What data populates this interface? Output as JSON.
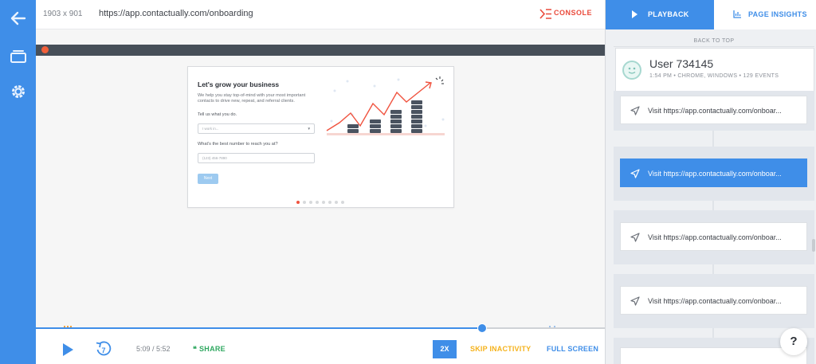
{
  "rail": {
    "back_icon": "arrow-left-icon",
    "sessions_icon": "stack-icon",
    "settings_icon": "gear-icon"
  },
  "topbar": {
    "dimensions": "1903 x 901",
    "url": "https://app.contactually.com/onboarding",
    "console_label": "CONSOLE"
  },
  "card": {
    "title": "Let's grow your business",
    "description": "We help you stay top-of-mind with your most important contacts to drive new, repeat, and referral clients.",
    "label_1": "Tell us what you do.",
    "select_placeholder": "I work in...",
    "label_2": "What's the best number to reach you at?",
    "phone_placeholder": "(123) 456-7890",
    "next_label": "Next",
    "progress_step": 1,
    "progress_total": 8
  },
  "controls": {
    "time": "5:09 / 5:52",
    "rewind_seconds": "7",
    "share_label": "SHARE",
    "speed_label": "2X",
    "skip_label": "SKIP INACTIVITY",
    "fullscreen_label": "FULL SCREEN",
    "progress_fraction": 0.88
  },
  "panel": {
    "tab_playback": "PLAYBACK",
    "tab_insights": "PAGE INSIGHTS",
    "back_to_top": "BACK TO TOP",
    "user_name": "User 734145",
    "user_meta": "1:54 PM • CHROME, WINDOWS • 129 EVENTS",
    "events": [
      {
        "text": "Visit https://app.contactually.com/onboar..."
      },
      {
        "text": "Visit https://app.contactually.com/onboar..."
      },
      {
        "text": "Visit https://app.contactually.com/onboar..."
      },
      {
        "text": "Visit https://app.contactually.com/onboar..."
      }
    ],
    "help_label": "?"
  },
  "colors": {
    "accent": "#3f8ee8",
    "console": "#ea4a3b",
    "share": "#2fa860",
    "skip": "#f5b21b"
  }
}
